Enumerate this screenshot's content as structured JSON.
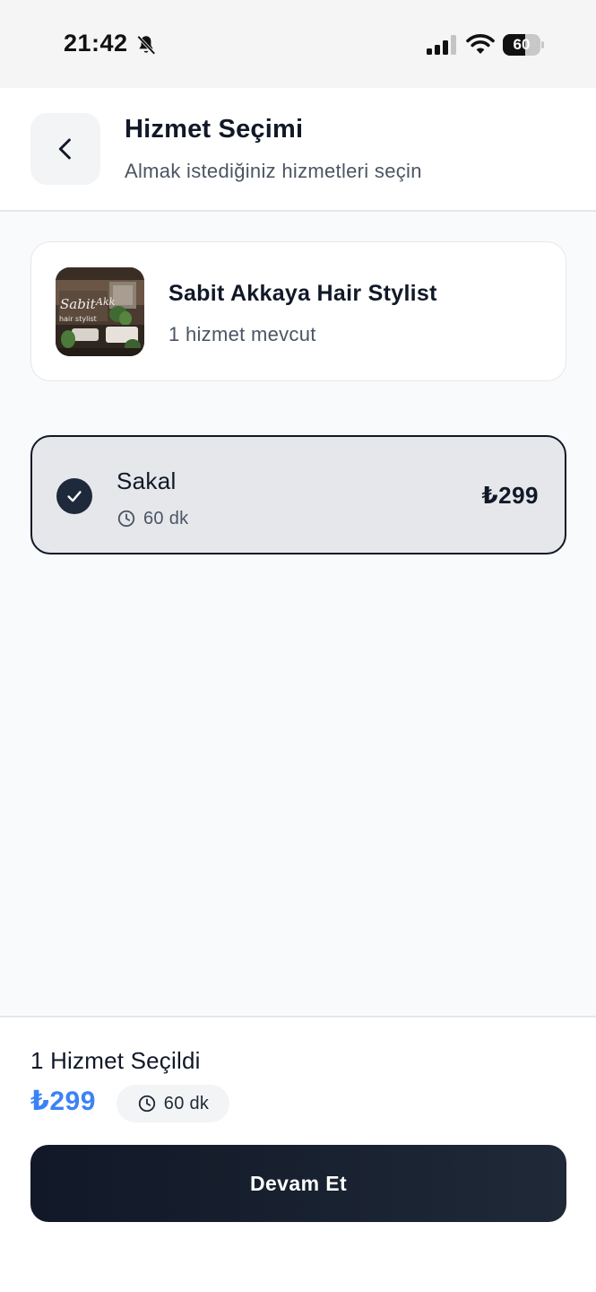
{
  "status_bar": {
    "time": "21:42",
    "battery_level": "60",
    "battery_fraction": 0.6,
    "icons": [
      "bell-off-icon",
      "signal-icon",
      "wifi-icon",
      "battery-icon"
    ]
  },
  "header": {
    "title": "Hizmet Seçimi",
    "subtitle": "Almak istediğiniz hizmetleri seçin",
    "back_icon": "chevron-left-icon"
  },
  "salon": {
    "name": "Sabit Akkaya Hair Stylist",
    "service_count": "1 hizmet mevcut"
  },
  "services": [
    {
      "name": "Sakal",
      "duration": "60 dk",
      "price": "₺299",
      "selected": true
    }
  ],
  "summary": {
    "selected_label": "1 Hizmet Seçildi",
    "total_price": "₺299",
    "total_duration": "60 dk"
  },
  "actions": {
    "continue_label": "Devam Et"
  },
  "colors": {
    "accent": "#3b82f6",
    "dark": "#111827",
    "selected_bg": "#e5e7eb"
  }
}
